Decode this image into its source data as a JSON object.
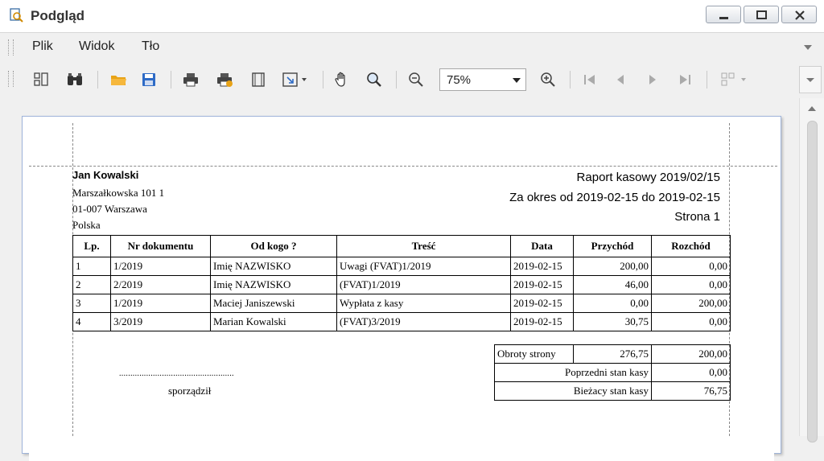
{
  "window": {
    "title": "Podgląd"
  },
  "menu": [
    "Plik",
    "Widok",
    "Tło"
  ],
  "toolbar": {
    "zoom": "75%"
  },
  "report": {
    "company": {
      "name": "Jan  Kowalski",
      "street": "Marszałkowska 101 1",
      "city": "01-007 Warszawa",
      "country": "Polska"
    },
    "title": "Raport kasowy 2019/02/15",
    "period": "Za okres od 2019-02-15 do 2019-02-15",
    "page": "Strona 1",
    "columns": [
      "Lp.",
      "Nr dokumentu",
      "Od kogo ?",
      "Treść",
      "Data",
      "Przychód",
      "Rozchód"
    ],
    "rows": [
      [
        "1",
        "1/2019",
        "Imię NAZWISKO",
        "Uwagi (FVAT)1/2019",
        "2019-02-15",
        "200,00",
        "0,00"
      ],
      [
        "2",
        "2/2019",
        "Imię NAZWISKO",
        "(FVAT)1/2019",
        "2019-02-15",
        "46,00",
        "0,00"
      ],
      [
        "3",
        "1/2019",
        "Maciej  Janiszewski",
        "Wypłata z kasy",
        "2019-02-15",
        "0,00",
        "200,00"
      ],
      [
        "4",
        "3/2019",
        "Marian Kowalski",
        "(FVAT)3/2019",
        "2019-02-15",
        "30,75",
        "0,00"
      ]
    ],
    "summary": {
      "page_turnover_label": "Obroty strony",
      "page_turnover_in": "276,75",
      "page_turnover_out": "200,00",
      "prev_label": "Poprzedni stan kasy",
      "prev_value": "0,00",
      "curr_label": "Bieżacy stan kasy",
      "curr_value": "76,75"
    },
    "signature_dots": "...................................................",
    "signature_label": "sporządził"
  }
}
